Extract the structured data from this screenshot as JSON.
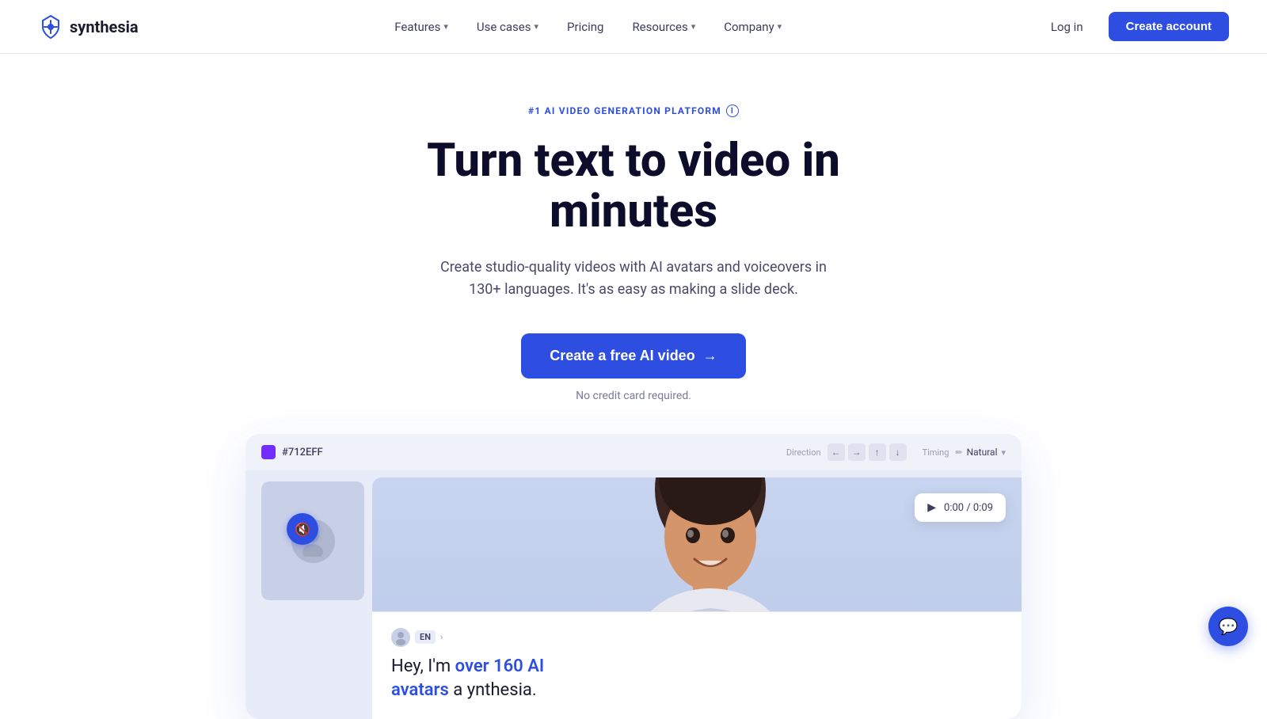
{
  "nav": {
    "logo_text": "synthesia",
    "links": [
      {
        "label": "Features",
        "has_dropdown": true
      },
      {
        "label": "Use cases",
        "has_dropdown": true
      },
      {
        "label": "Pricing",
        "has_dropdown": false
      },
      {
        "label": "Resources",
        "has_dropdown": true
      },
      {
        "label": "Company",
        "has_dropdown": true
      }
    ],
    "login_label": "Log in",
    "create_account_label": "Create account"
  },
  "hero": {
    "badge_text": "#1 AI VIDEO GENERATION PLATFORM",
    "title": "Turn text to video in minutes",
    "subtitle": "Create studio-quality videos with AI avatars and voiceovers in 130+ languages. It's as easy as making a slide deck.",
    "cta_label": "Create a free AI video",
    "cta_note": "No credit card required."
  },
  "demo": {
    "color_hex": "#712EFF",
    "direction_label": "Direction",
    "timing_label": "Timing",
    "timing_value": "Natural",
    "player_time": "0:00 / 0:09",
    "lang_code": "EN",
    "transcript_partial": "Hey, I'm",
    "transcript_highlight1": "over 160 AI",
    "transcript_highlight2": "avatars",
    "transcript_suffix": "a",
    "transcript_end": "ynthesia."
  },
  "chat": {
    "icon": "💬"
  }
}
